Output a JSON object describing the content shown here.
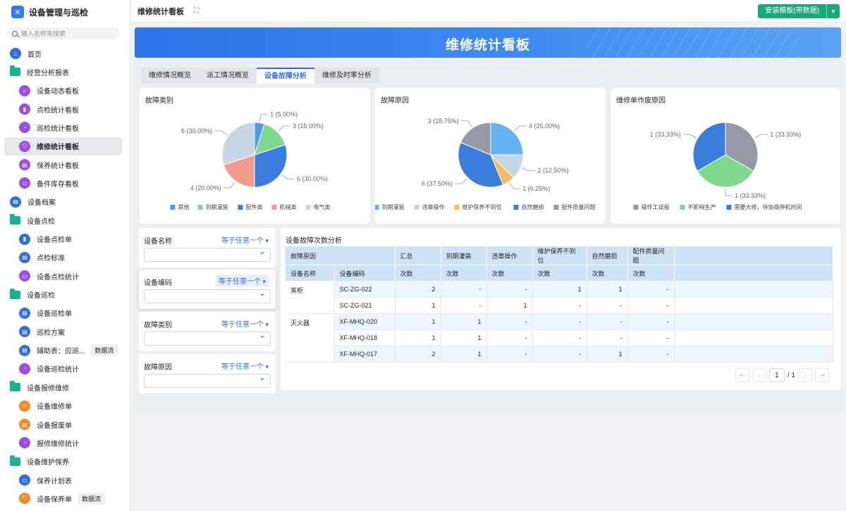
{
  "app": {
    "name": "设备管理与巡检",
    "search_placeholder": "输入名称来搜索"
  },
  "sidebar": {
    "items": [
      {
        "label": "首页",
        "level": "top",
        "icon": "home-icon",
        "color": "blue",
        "glyph": "⌂"
      },
      {
        "label": "经营分析报表",
        "level": "top",
        "icon": "folder-icon",
        "color": "folder",
        "glyph": ""
      },
      {
        "label": "设备动态看板",
        "level": "sub",
        "icon": "home-icon",
        "color": "purple",
        "glyph": "⌂"
      },
      {
        "label": "点检统计看板",
        "level": "sub",
        "icon": "bar-chart-icon",
        "color": "purple",
        "glyph": "▮"
      },
      {
        "label": "巡检统计看板",
        "level": "sub",
        "icon": "pie-chart-icon",
        "color": "purple",
        "glyph": "◔"
      },
      {
        "label": "维修统计看板",
        "level": "sub",
        "icon": "shield-icon",
        "color": "purple",
        "glyph": "⛉",
        "active": true
      },
      {
        "label": "保养统计看板",
        "level": "sub",
        "icon": "document-icon",
        "color": "purple",
        "glyph": "▤"
      },
      {
        "label": "备件库存看板",
        "level": "sub",
        "icon": "inbox-icon",
        "color": "purple",
        "glyph": "▭"
      },
      {
        "label": "设备档案",
        "level": "top",
        "icon": "document-icon",
        "color": "blue",
        "glyph": "▤"
      },
      {
        "label": "设备点检",
        "level": "top",
        "icon": "folder-icon",
        "color": "folder",
        "glyph": ""
      },
      {
        "label": "设备点检单",
        "level": "sub",
        "icon": "bookmark-icon",
        "color": "blue",
        "glyph": "▮"
      },
      {
        "label": "点检标准",
        "level": "sub",
        "icon": "document-icon",
        "color": "blue",
        "glyph": "▤"
      },
      {
        "label": "设备点检统计",
        "level": "sub",
        "icon": "inbox-icon",
        "color": "purple",
        "glyph": "▭"
      },
      {
        "label": "设备巡检",
        "level": "top",
        "icon": "folder-icon",
        "color": "folder",
        "glyph": ""
      },
      {
        "label": "设备巡检单",
        "level": "sub",
        "icon": "document-icon",
        "color": "blue",
        "glyph": "▤"
      },
      {
        "label": "巡检方案",
        "level": "sub",
        "icon": "document-icon",
        "color": "blue",
        "glyph": "▤"
      },
      {
        "label": "辅助表：应巡...",
        "level": "sub",
        "icon": "document-icon",
        "color": "blue",
        "glyph": "▤",
        "badge": "数据流"
      },
      {
        "label": "设备巡检统计",
        "level": "sub",
        "icon": "pie-chart-icon",
        "color": "purple",
        "glyph": "◔"
      },
      {
        "label": "设备报修维修",
        "level": "top",
        "icon": "folder-icon",
        "color": "folder",
        "glyph": ""
      },
      {
        "label": "设备维修单",
        "level": "sub",
        "icon": "user-icon",
        "color": "orange",
        "glyph": "☺"
      },
      {
        "label": "设备报废单",
        "level": "sub",
        "icon": "document-icon",
        "color": "orange",
        "glyph": "▤"
      },
      {
        "label": "报修维修统计",
        "level": "sub",
        "icon": "pie-chart-icon",
        "color": "purple",
        "glyph": "◔"
      },
      {
        "label": "设备维护保养",
        "level": "top",
        "icon": "folder-icon",
        "color": "folder",
        "glyph": ""
      },
      {
        "label": "保养计划表",
        "level": "sub",
        "icon": "card-icon",
        "color": "blue",
        "glyph": "▭"
      },
      {
        "label": "设备保养单",
        "level": "sub",
        "icon": "shield-icon",
        "color": "orange",
        "glyph": "⛉",
        "badge": "数据流"
      }
    ]
  },
  "header": {
    "title": "维修统计看板",
    "install_label": "安装模板(带数据)"
  },
  "banner": {
    "title": "维修统计看板"
  },
  "tabs": [
    {
      "label": "维修情况概览"
    },
    {
      "label": "派工情况概览"
    },
    {
      "label": "设备故障分析",
      "active": true
    },
    {
      "label": "维修及时率分析"
    }
  ],
  "chart_data": [
    {
      "type": "pie",
      "title": "故障类别",
      "labels": [
        "其他",
        "到期灌装",
        "配件类",
        "机械类",
        "电气类"
      ],
      "values": [
        1,
        3,
        6,
        4,
        6
      ],
      "percents": [
        "5.00%",
        "15.00%",
        "30.00%",
        "20.00%",
        "30.00%"
      ],
      "colors": [
        "#4f9be9",
        "#7fd88e",
        "#3b7ddd",
        "#f59b8c",
        "#c7d7e8"
      ],
      "legend_position": "bottom"
    },
    {
      "type": "pie",
      "title": "故障原因",
      "labels": [
        "到期灌装",
        "违章操作",
        "维护保养不到位",
        "自然磨损",
        "配件质量问题"
      ],
      "values": [
        4,
        2,
        1,
        6,
        3
      ],
      "percents": [
        "25.00%",
        "12.50%",
        "6.25%",
        "37.50%",
        "18.75%"
      ],
      "colors": [
        "#64b2f0",
        "#c2d6e6",
        "#f5bd5c",
        "#3b7ddd",
        "#9899a8"
      ],
      "legend_position": "bottom"
    },
    {
      "type": "pie",
      "title": "维修单作废原因",
      "labels": [
        "操作工误报",
        "不影响生产",
        "需要大修，待协商停机时间"
      ],
      "values": [
        1,
        1,
        1
      ],
      "percents": [
        "33.33%",
        "33.33%",
        "33.33%"
      ],
      "colors": [
        "#9899a8",
        "#7fd88e",
        "#3b7ddd"
      ],
      "legend_position": "bottom"
    }
  ],
  "filters": [
    {
      "label": "设备名称",
      "op": "等于任意一个"
    },
    {
      "label": "设备编码",
      "op": "等于任意一个"
    },
    {
      "label": "故障类别",
      "op": "等于任意一个"
    },
    {
      "label": "故障原因",
      "op": "等于任意一个"
    }
  ],
  "table": {
    "title": "设备故障次数分析",
    "header_row1": [
      "故障原因",
      "汇总",
      "到期灌装",
      "违章操作",
      "维护保养不到位",
      "自然磨损",
      "配件质量问题"
    ],
    "header_row2": [
      "设备名称",
      "设备编码",
      "次数",
      "次数",
      "次数",
      "次数",
      "次数",
      "次数"
    ],
    "rows": [
      {
        "group": "蒸柜",
        "code": "SC-ZG-022",
        "cells": [
          "2",
          "-",
          "-",
          "1",
          "1",
          "-"
        ]
      },
      {
        "group": "",
        "code": "SC-ZG-021",
        "cells": [
          "1",
          "-",
          "1",
          "-",
          "-",
          "-"
        ]
      },
      {
        "group": "灭火器",
        "code": "XF-MHQ-020",
        "cells": [
          "1",
          "1",
          "-",
          "-",
          "-",
          "-"
        ]
      },
      {
        "group": "",
        "code": "XF-MHQ-018",
        "cells": [
          "1",
          "1",
          "-",
          "-",
          "-",
          "-"
        ]
      },
      {
        "group": "",
        "code": "XF-MHQ-017",
        "cells": [
          "2",
          "1",
          "-",
          "-",
          "1",
          "-"
        ]
      }
    ]
  },
  "pager": {
    "current": "1",
    "total": "/ 1"
  }
}
